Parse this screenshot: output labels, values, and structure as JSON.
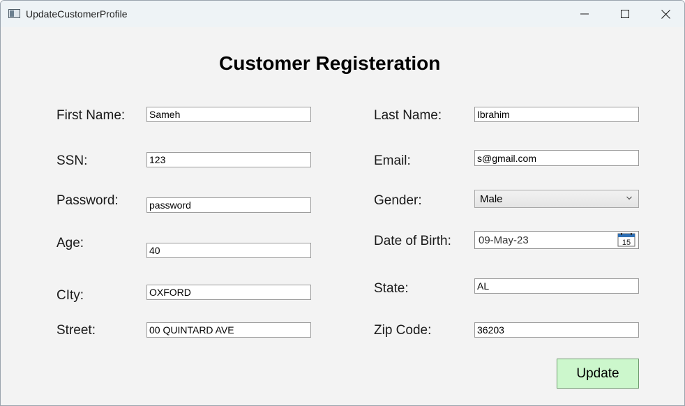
{
  "window": {
    "title": "UpdateCustomerProfile",
    "controls": [
      "minimize-icon",
      "maximize-icon",
      "close-icon"
    ]
  },
  "form": {
    "title": "Customer Registeration",
    "left": {
      "first_name_label": "First Name:",
      "first_name_value": "Sameh",
      "ssn_label": "SSN:",
      "ssn_value": "123",
      "password_label": "Password:",
      "password_value": "password",
      "age_label": "Age:",
      "age_value": "40",
      "city_label": "CIty:",
      "city_value": "OXFORD",
      "street_label": "Street:",
      "street_value": "00 QUINTARD AVE"
    },
    "right": {
      "last_name_label": "Last Name:",
      "last_name_value": "Ibrahim",
      "email_label": "Email:",
      "email_value": "s@gmail.com",
      "gender_label": "Gender:",
      "gender_value": "Male",
      "dob_label": "Date of Birth:",
      "dob_value": "09-May-23",
      "calendar_day": "15",
      "state_label": "State:",
      "state_value": "AL",
      "zip_label": "Zip Code:",
      "zip_value": "36203"
    },
    "update_button": "Update"
  },
  "colors": {
    "titlebar": "#eef3f6",
    "background": "#f3f3f3",
    "update_button": "#ccf7cc"
  }
}
